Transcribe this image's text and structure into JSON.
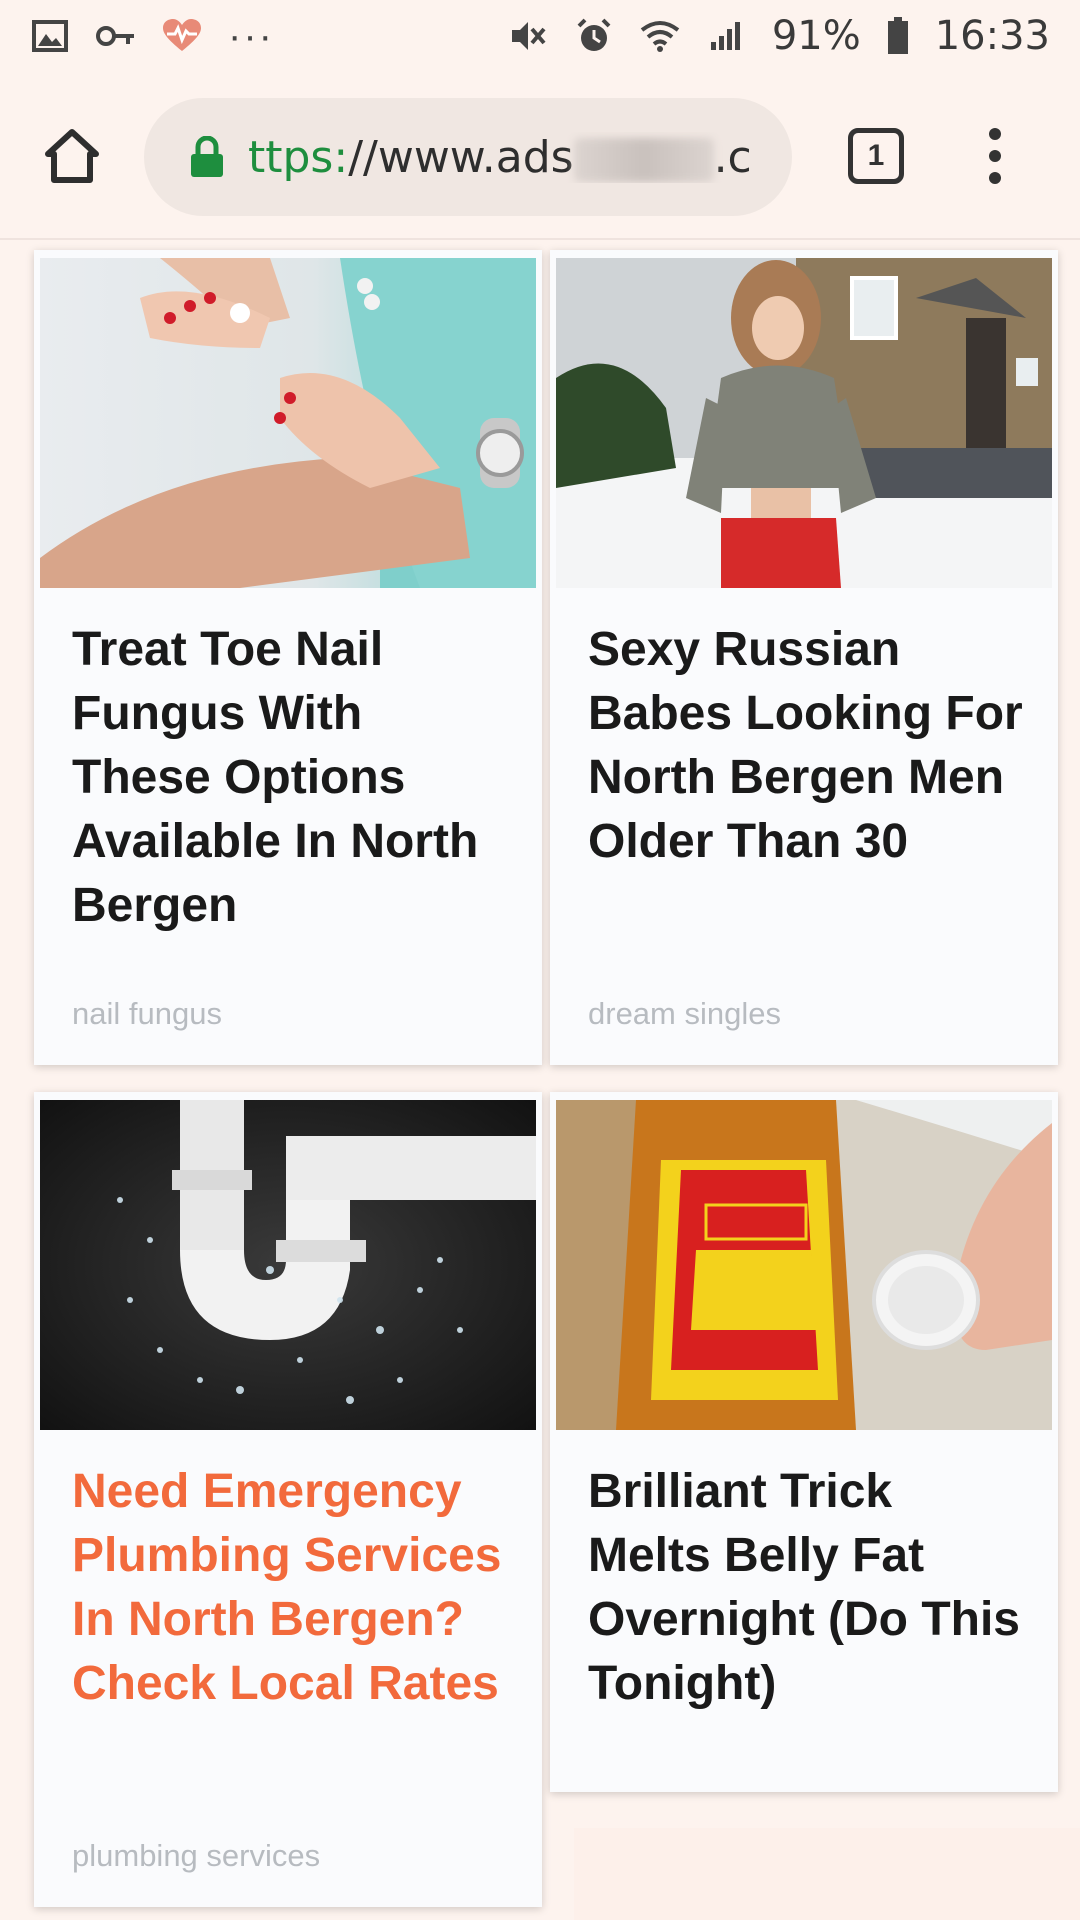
{
  "status_bar": {
    "left_icons": [
      "image-icon",
      "key-icon",
      "heart-pulse-icon"
    ],
    "more": "···",
    "right_icons": [
      "mute-icon",
      "alarm-icon",
      "wifi-icon",
      "signal-icon"
    ],
    "battery": "91%",
    "time": "16:33"
  },
  "browser": {
    "url_scheme": "ttps:",
    "url_rest_before": "//www.ads",
    "url_rest_after": ".c",
    "tab_count": "1"
  },
  "cards": [
    {
      "title": "Treat Toe Nail Fungus With These Options Available In North Bergen",
      "tag": "nail fungus",
      "image": "hands-foot-care-photo"
    },
    {
      "title": "Sexy Russian Babes Looking For North Bergen Men Older Than 30",
      "tag": "dream singles",
      "image": "woman-snow-house-photo"
    },
    {
      "title": "Need Emergency Plumbing Services In North Bergen? Check Local Rates",
      "tag": "plumbing services",
      "image": "leaking-pipe-photo",
      "title_color": "#f26a3c"
    },
    {
      "title": "Brilliant Trick Melts Belly Fat Overnight (Do This Tonight)",
      "tag": "",
      "image": "vinegar-bottle-photo"
    }
  ]
}
